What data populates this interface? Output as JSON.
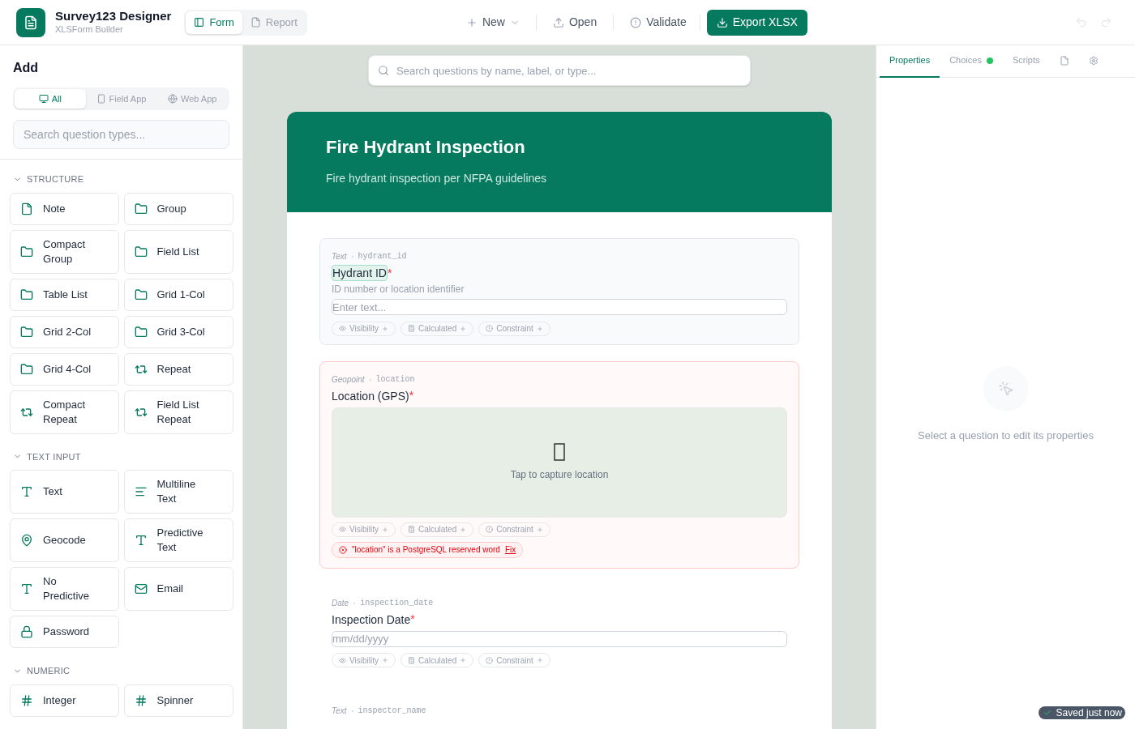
{
  "app": {
    "title": "Survey123 Designer",
    "subtitle": "XLSForm Builder"
  },
  "view_tabs": [
    {
      "label": "Form",
      "selected": true,
      "kind": "form"
    },
    {
      "label": "Report",
      "selected": false,
      "kind": "report"
    }
  ],
  "toolbar": [
    {
      "label": "New",
      "kind": "new"
    },
    {
      "label": "Open",
      "kind": "open"
    },
    {
      "label": "Validate",
      "kind": "validate"
    },
    {
      "label": "Export XLSX",
      "kind": "export"
    }
  ],
  "history": {
    "undo_disabled": true,
    "redo_disabled": true
  },
  "sidebar": {
    "title": "Add",
    "platform_tabs": [
      {
        "label": "All",
        "selected": true,
        "kind": "all"
      },
      {
        "label": "Field App",
        "selected": false,
        "kind": "field"
      },
      {
        "label": "Web App",
        "selected": false,
        "kind": "web"
      }
    ],
    "search": {
      "placeholder": "Search question types..."
    },
    "sections": [
      {
        "title": "STRUCTURE",
        "expanded": true,
        "items": [
          {
            "label": "Note",
            "kind": "note"
          },
          {
            "label": "Group",
            "kind": "folder"
          },
          {
            "label": "Compact Group",
            "kind": "folder"
          },
          {
            "label": "Field List",
            "kind": "folder"
          },
          {
            "label": "Table List",
            "kind": "folder"
          },
          {
            "label": "Grid 1-Col",
            "kind": "folder"
          },
          {
            "label": "Grid 2-Col",
            "kind": "folder"
          },
          {
            "label": "Grid 3-Col",
            "kind": "folder"
          },
          {
            "label": "Grid 4-Col",
            "kind": "folder"
          },
          {
            "label": "Repeat",
            "kind": "repeat"
          },
          {
            "label": "Compact Repeat",
            "kind": "repeat"
          },
          {
            "label": "Field List Repeat",
            "kind": "repeat"
          }
        ]
      },
      {
        "title": "TEXT INPUT",
        "expanded": true,
        "items": [
          {
            "label": "Text",
            "kind": "text"
          },
          {
            "label": "Multiline Text",
            "kind": "lines"
          },
          {
            "label": "Geocode",
            "kind": "pin"
          },
          {
            "label": "Predictive Text",
            "kind": "text"
          },
          {
            "label": "No Predictive",
            "kind": "text"
          },
          {
            "label": "Email",
            "kind": "mail"
          },
          {
            "label": "Password",
            "kind": "lock"
          }
        ]
      },
      {
        "title": "NUMERIC",
        "expanded": true,
        "items": [
          {
            "label": "Integer",
            "kind": "hash"
          },
          {
            "label": "Spinner",
            "kind": "hash"
          }
        ]
      }
    ]
  },
  "canvas": {
    "search": {
      "placeholder": "Search questions by name, label, or type..."
    },
    "form": {
      "title": "Fire Hydrant Inspection",
      "description": "Fire hydrant inspection per NFPA guidelines"
    },
    "questions": [
      {
        "kind": "text",
        "type": "Text",
        "name": "hydrant_id",
        "label": "Hydrant ID",
        "required": "*",
        "highlighted": true,
        "hint": "ID number or location identifier",
        "placeholder": "Enter text...",
        "chips": [
          "Visibility",
          "Calculated",
          "Constraint"
        ]
      },
      {
        "kind": "geopoint",
        "type": "Geopoint",
        "name": "location",
        "label": "Location (GPS)",
        "required": "*",
        "highlighted": false,
        "capture": "Tap to capture location",
        "chips": [
          "Visibility",
          "Calculated",
          "Constraint"
        ],
        "error": {
          "message": "\"location\" is a PostgreSQL reserved word",
          "action": "Fix"
        }
      },
      {
        "kind": "date",
        "type": "Date",
        "name": "inspection_date",
        "label": "Inspection Date",
        "required": "*",
        "highlighted": false,
        "placeholder": "mm/dd/yyyy",
        "chips": [
          "Visibility",
          "Calculated",
          "Constraint"
        ]
      },
      {
        "kind": "text",
        "type": "Text",
        "name": "inspector_name",
        "highlighted": false
      }
    ]
  },
  "right_panel": {
    "tabs": [
      {
        "label": "Properties",
        "selected": true,
        "kind": "text"
      },
      {
        "label": "Choices",
        "selected": false,
        "kind": "text",
        "color": "#22c55e"
      },
      {
        "label": "Scripts",
        "selected": false,
        "kind": "text"
      },
      {
        "selected": false,
        "kind": "file"
      },
      {
        "selected": false,
        "kind": "gear"
      }
    ],
    "empty_message": "Select a question to edit its properties"
  },
  "status": {
    "label": "Saved just now"
  }
}
